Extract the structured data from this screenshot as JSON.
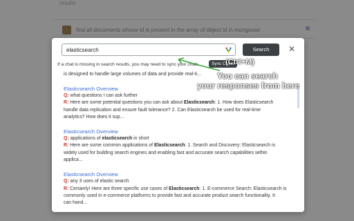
{
  "background": {
    "top_line": "results",
    "row_text": "find all documents whose id is present in the array of object id in mongoose"
  },
  "search": {
    "value": "elasticsearch",
    "button_label": "Search",
    "close_label": "✕"
  },
  "notice": {
    "text": "If a chat is missing in search results, you may need to sync your chats.",
    "sync_label": "Sync Chats"
  },
  "results": {
    "partial_line": "is designed to handle large volumes of data and provide real-ti...",
    "items": [
      {
        "title": "Elasticsearch Overview",
        "q_label": "Q:",
        "q_text": "what questions I can ask further",
        "r_label": "R:",
        "r_before": "Here are some potential questions you can ask about ",
        "r_highlight": "Elasticsearch",
        "r_after": ": 1. How does Elasticsearch",
        "line2": "handle data replication and ensure fault tolerance? 2. Can Elasticsearch be used for real-time",
        "line3": "analytics? How does it sup..."
      },
      {
        "title": "Elasticsearch Overview",
        "q_label": "Q:",
        "q_before": "applications of ",
        "q_highlight": "elasticsearch",
        "q_after": " in short",
        "r_label": "R:",
        "r_before": "Here are some common applications of ",
        "r_highlight": "Elasticsearch",
        "r_after": ": 1. Search and Discovery: Elasticsearch is",
        "line2": "widely used for building search engines and enabling fast and accurate search capabilities within",
        "line3": "applica..."
      },
      {
        "title": "Elasticsearch Overview",
        "q_label": "Q:",
        "q_text": "any 3 uses of elastic search",
        "r_label": "R:",
        "r_before": "Certainly! Here are three specific use cases of ",
        "r_highlight": "Elasticsearch",
        "r_after": ": 1. E-commerce Search: Elasticsearch is",
        "line2": "commonly used in e-commerce platforms to provide fast and accurate product search functionality. It",
        "line3": "can hand..."
      }
    ]
  },
  "annotation": {
    "shortcut": "(Ctrl+M)",
    "line1": "You can search",
    "line2": "your responses from here",
    "color": "#ffffff",
    "arrow_color": "#3aa53a"
  },
  "colors": {
    "link": "#3f6bd0",
    "label_red": "#c0392b",
    "button_dark": "#3c4043"
  },
  "icons": {
    "mic": "microphone-icon",
    "close": "close-icon"
  }
}
